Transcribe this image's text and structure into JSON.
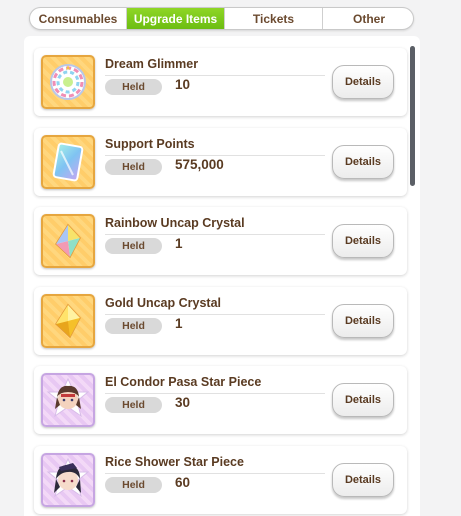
{
  "tabs": [
    {
      "label": "Consumables",
      "active": false
    },
    {
      "label": "Upgrade Items",
      "active": true
    },
    {
      "label": "Tickets",
      "active": false
    },
    {
      "label": "Other",
      "active": false
    }
  ],
  "colors": {
    "active_tab": "#7cc91a",
    "text_brown": "#5a3b22",
    "thumb_gold_border": "#e6a63f",
    "thumb_purple_border": "#c6a5e2"
  },
  "items": [
    {
      "name": "Dream Glimmer",
      "held_label": "Held",
      "quantity": "10",
      "details_label": "Details",
      "icon": "dream-glimmer-icon"
    },
    {
      "name": "Support Points",
      "held_label": "Held",
      "quantity": "575,000",
      "details_label": "Details",
      "icon": "support-points-icon"
    },
    {
      "name": "Rainbow Uncap Crystal",
      "held_label": "Held",
      "quantity": "1",
      "details_label": "Details",
      "icon": "rainbow-crystal-icon"
    },
    {
      "name": "Gold Uncap Crystal",
      "held_label": "Held",
      "quantity": "1",
      "details_label": "Details",
      "icon": "gold-crystal-icon"
    },
    {
      "name": "El Condor Pasa Star Piece",
      "held_label": "Held",
      "quantity": "30",
      "details_label": "Details",
      "icon": "character-portrait-icon"
    },
    {
      "name": "Rice Shower Star Piece",
      "held_label": "Held",
      "quantity": "60",
      "details_label": "Details",
      "icon": "character-portrait-icon"
    }
  ]
}
